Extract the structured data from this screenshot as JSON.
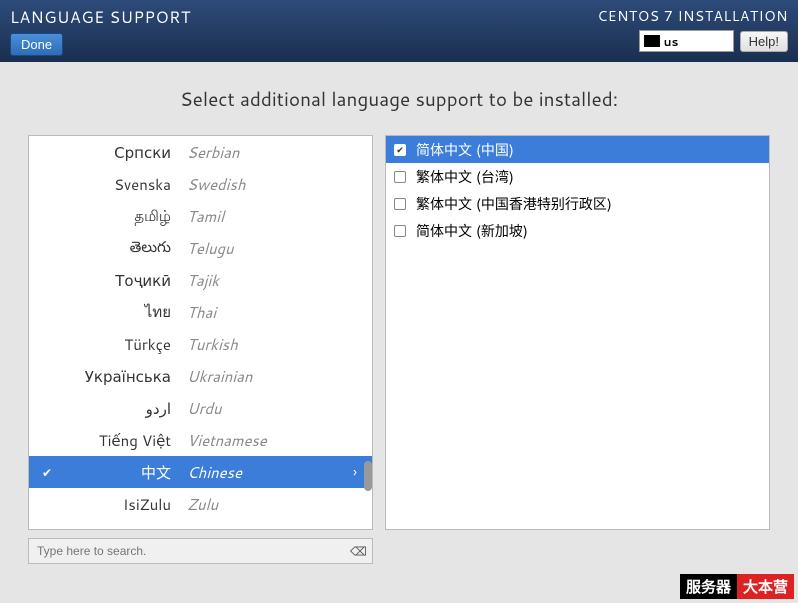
{
  "header": {
    "title": "LANGUAGE SUPPORT",
    "install_title": "CENTOS 7 INSTALLATION",
    "done_label": "Done",
    "help_label": "Help!",
    "keyboard_layout": "us"
  },
  "instruction": "Select additional language support to be installed:",
  "languages": [
    {
      "native": "Српски",
      "english": "Serbian",
      "selected": false,
      "checked": false
    },
    {
      "native": "Svenska",
      "english": "Swedish",
      "selected": false,
      "checked": false
    },
    {
      "native": "தமிழ்",
      "english": "Tamil",
      "selected": false,
      "checked": false
    },
    {
      "native": "తెలుగు",
      "english": "Telugu",
      "selected": false,
      "checked": false
    },
    {
      "native": "Тоҷикӣ",
      "english": "Tajik",
      "selected": false,
      "checked": false
    },
    {
      "native": "ไทย",
      "english": "Thai",
      "selected": false,
      "checked": false
    },
    {
      "native": "Türkçe",
      "english": "Turkish",
      "selected": false,
      "checked": false
    },
    {
      "native": "Українська",
      "english": "Ukrainian",
      "selected": false,
      "checked": false
    },
    {
      "native": "اردو",
      "english": "Urdu",
      "selected": false,
      "checked": false
    },
    {
      "native": "Tiếng Việt",
      "english": "Vietnamese",
      "selected": false,
      "checked": false
    },
    {
      "native": "中文",
      "english": "Chinese",
      "selected": true,
      "checked": true
    },
    {
      "native": "IsiZulu",
      "english": "Zulu",
      "selected": false,
      "checked": false
    }
  ],
  "locales": [
    {
      "label": "简体中文 (中国)",
      "selected": true,
      "checked": true
    },
    {
      "label": "繁体中文 (台湾)",
      "selected": false,
      "checked": false
    },
    {
      "label": "繁体中文 (中国香港特别行政区)",
      "selected": false,
      "checked": false
    },
    {
      "label": "简体中文 (新加坡)",
      "selected": false,
      "checked": false
    }
  ],
  "search": {
    "placeholder": "Type here to search."
  },
  "watermark": {
    "left": "服务器",
    "right": "大本营"
  }
}
